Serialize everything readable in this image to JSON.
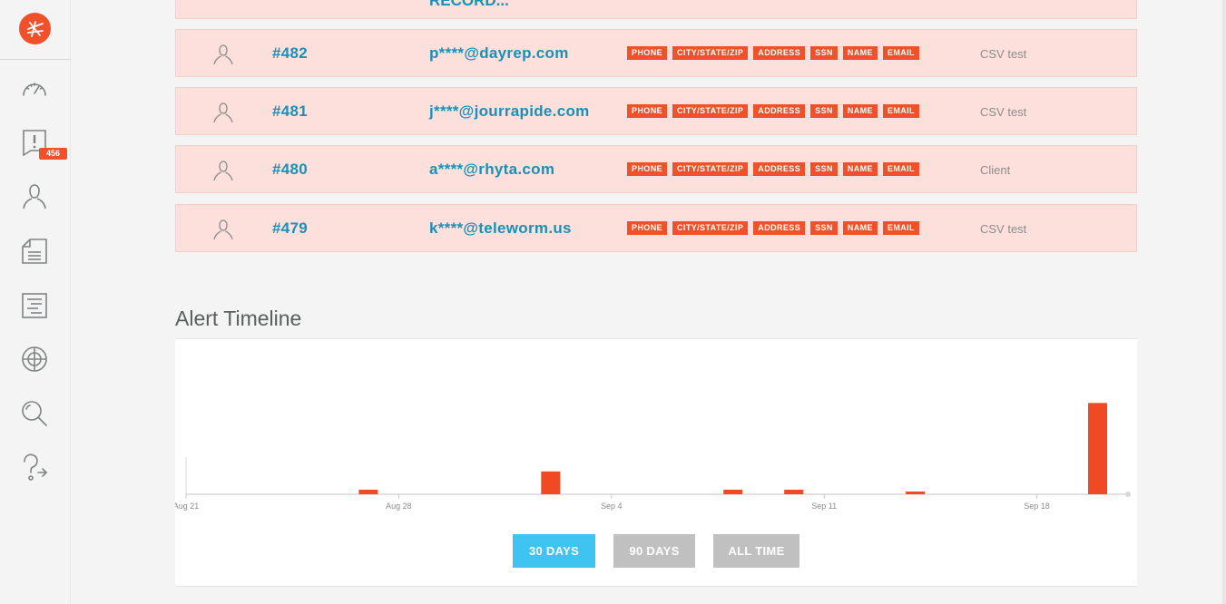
{
  "sidebar": {
    "badge_count": "456",
    "items": [
      {
        "name": "dashboard",
        "icon": "speedometer-icon"
      },
      {
        "name": "alerts",
        "icon": "alert-icon"
      },
      {
        "name": "users",
        "icon": "user-icon"
      },
      {
        "name": "documents",
        "icon": "document-icon"
      },
      {
        "name": "reports",
        "icon": "report-icon"
      },
      {
        "name": "targets",
        "icon": "globe-icon"
      },
      {
        "name": "search",
        "icon": "search-icon"
      },
      {
        "name": "help",
        "icon": "help-icon"
      }
    ]
  },
  "rows": [
    {
      "id": "#482",
      "email": "p****@dayrep.com",
      "tags": [
        "PHONE",
        "CITY/STATE/ZIP",
        "ADDRESS",
        "SSN",
        "NAME",
        "EMAIL"
      ],
      "source": "CSV test"
    },
    {
      "id": "#481",
      "email": "j****@jourrapide.com",
      "tags": [
        "PHONE",
        "CITY/STATE/ZIP",
        "ADDRESS",
        "SSN",
        "NAME",
        "EMAIL"
      ],
      "source": "CSV test"
    },
    {
      "id": "#480",
      "email": "a****@rhyta.com",
      "tags": [
        "PHONE",
        "CITY/STATE/ZIP",
        "ADDRESS",
        "SSN",
        "NAME",
        "EMAIL"
      ],
      "source": "Client"
    },
    {
      "id": "#479",
      "email": "k****@teleworm.us",
      "tags": [
        "PHONE",
        "CITY/STATE/ZIP",
        "ADDRESS",
        "SSN",
        "NAME",
        "EMAIL"
      ],
      "source": "CSV test"
    }
  ],
  "partial_row_text": "RECORD...",
  "timeline": {
    "title": "Alert Timeline",
    "buttons": {
      "days30": "30 DAYS",
      "days90": "90 DAYS",
      "all": "ALL TIME"
    }
  },
  "colors": {
    "accent": "#f0502a",
    "link": "#1a8fb8",
    "active_button": "#3fc3f1",
    "row_bg": "#fde0db"
  },
  "chart_data": {
    "type": "bar",
    "x_ticks": [
      "Aug 21",
      "Aug 28",
      "Sep 4",
      "Sep 11",
      "Sep 18"
    ],
    "x_range": [
      "Aug 21",
      "Sep 21"
    ],
    "points": [
      {
        "x": "Aug 27",
        "value": 1
      },
      {
        "x": "Sep 2",
        "value": 5
      },
      {
        "x": "Sep 8",
        "value": 1
      },
      {
        "x": "Sep 10",
        "value": 1
      },
      {
        "x": "Sep 14",
        "value": 0.6
      },
      {
        "x": "Sep 20",
        "value": 20
      }
    ],
    "ylim": [
      0,
      30
    ],
    "grid": false
  }
}
